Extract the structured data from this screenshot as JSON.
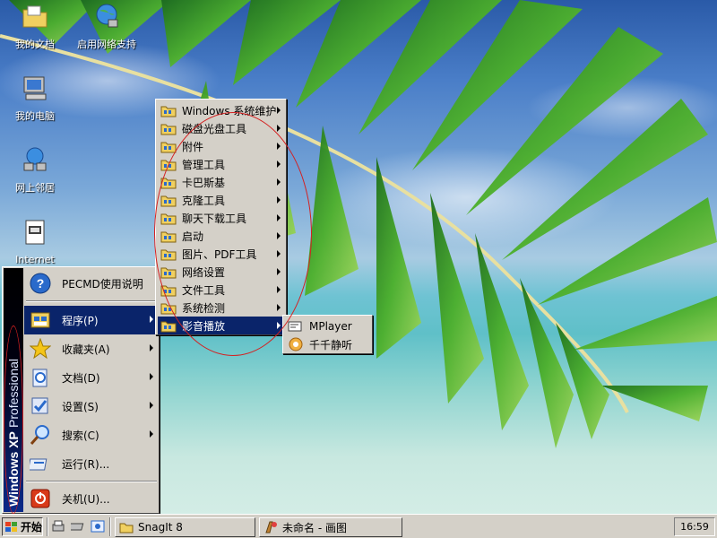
{
  "desktop": {
    "icons": [
      {
        "label": "我的文档",
        "icon": "my-documents-folder-icon"
      },
      {
        "label": "启用网络支持",
        "icon": "globe-network-icon"
      },
      {
        "label": "我的电脑",
        "icon": "my-computer-icon"
      },
      {
        "label": "网上邻居",
        "icon": "network-places-icon"
      },
      {
        "label": "Internet",
        "icon": "internet-icon"
      }
    ]
  },
  "start_menu": {
    "banner_bold": "Windows XP",
    "banner_thin": "Professional",
    "items": [
      {
        "label": "PECMD使用说明",
        "icon": "help-icon",
        "has_submenu": false
      },
      {
        "label": "程序(P)",
        "icon": "programs-icon",
        "has_submenu": true,
        "active": true
      },
      {
        "label": "收藏夹(A)",
        "icon": "favorites-star-icon",
        "has_submenu": true
      },
      {
        "label": "文档(D)",
        "icon": "documents-icon",
        "has_submenu": true
      },
      {
        "label": "设置(S)",
        "icon": "settings-icon",
        "has_submenu": true
      },
      {
        "label": "搜索(C)",
        "icon": "search-icon",
        "has_submenu": true
      },
      {
        "label": "运行(R)...",
        "icon": "run-icon",
        "has_submenu": false
      },
      {
        "label": "关机(U)...",
        "icon": "shutdown-icon",
        "has_submenu": false
      }
    ]
  },
  "programs_menu": {
    "items": [
      {
        "label": "Windows 系统维护"
      },
      {
        "label": "磁盘光盘工具"
      },
      {
        "label": "附件"
      },
      {
        "label": "管理工具"
      },
      {
        "label": "卡巴斯基"
      },
      {
        "label": "克隆工具"
      },
      {
        "label": "聊天下载工具"
      },
      {
        "label": "启动"
      },
      {
        "label": "图片、PDF工具"
      },
      {
        "label": "网络设置"
      },
      {
        "label": "文件工具"
      },
      {
        "label": "系统检测"
      },
      {
        "label": "影音播放",
        "active": true
      }
    ]
  },
  "media_menu": {
    "items": [
      {
        "label": "MPlayer",
        "icon": "mplayer-icon"
      },
      {
        "label": "千千静听",
        "icon": "ttplayer-icon"
      }
    ]
  },
  "taskbar": {
    "start_label": "开始",
    "tasks": [
      {
        "label": "SnagIt 8",
        "icon": "folder-icon"
      },
      {
        "label": "未命名 - 画图",
        "icon": "paint-icon"
      }
    ],
    "clock": "16:59"
  },
  "colors": {
    "menu_bg": "#d4d0c8",
    "highlight": "#0a246a",
    "annotation_red": "#d42020"
  }
}
